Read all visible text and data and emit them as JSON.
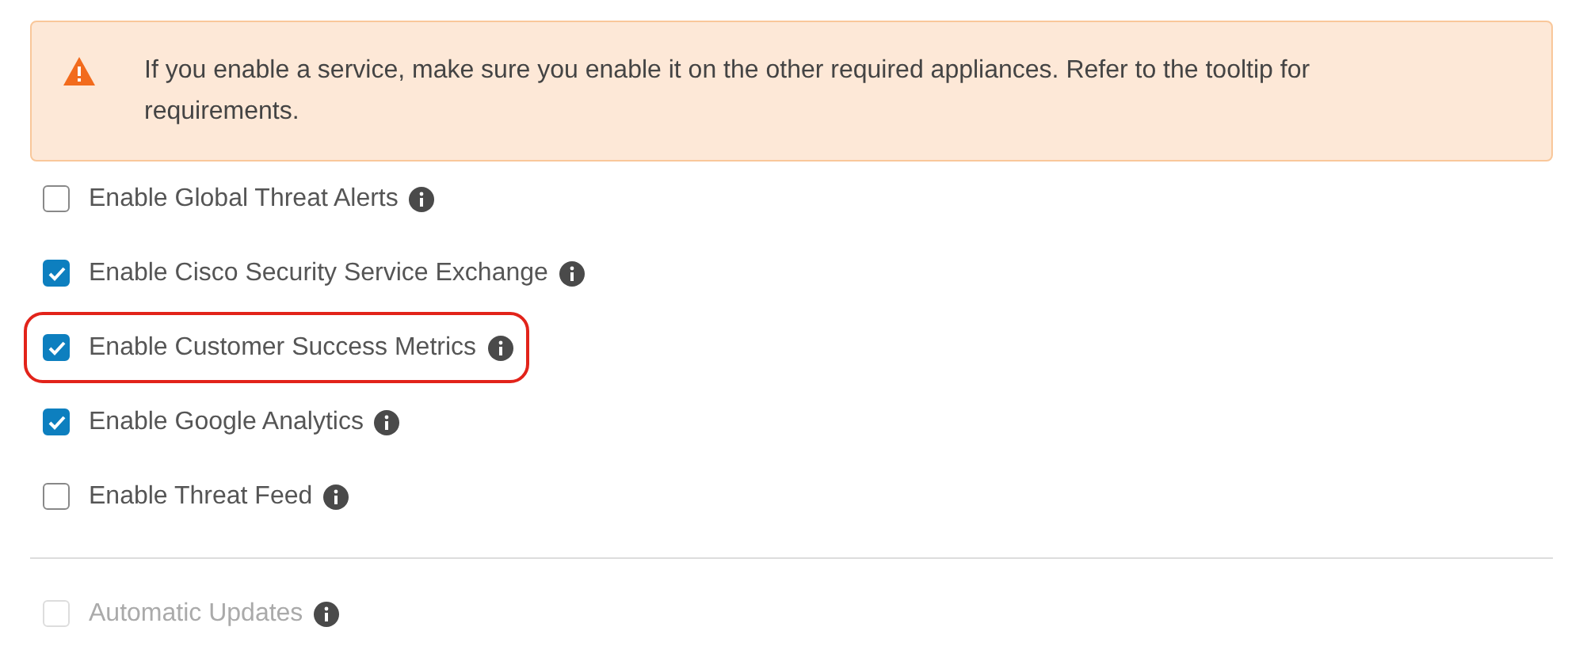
{
  "alert": {
    "kind": "warning",
    "text": "If you enable a service, make sure you enable it on the other required appliances. Refer to the tooltip for requirements."
  },
  "services": [
    {
      "label": "Enable Global Threat Alerts",
      "checked": false,
      "highlighted": false
    },
    {
      "label": "Enable Cisco Security Service Exchange",
      "checked": true,
      "highlighted": false
    },
    {
      "label": "Enable Customer Success Metrics",
      "checked": true,
      "highlighted": true
    },
    {
      "label": "Enable Google Analytics",
      "checked": true,
      "highlighted": false
    },
    {
      "label": "Enable Threat Feed",
      "checked": false,
      "highlighted": false
    }
  ],
  "updates": [
    {
      "label": "Automatic Updates",
      "checked": false,
      "disabled": true
    }
  ]
}
